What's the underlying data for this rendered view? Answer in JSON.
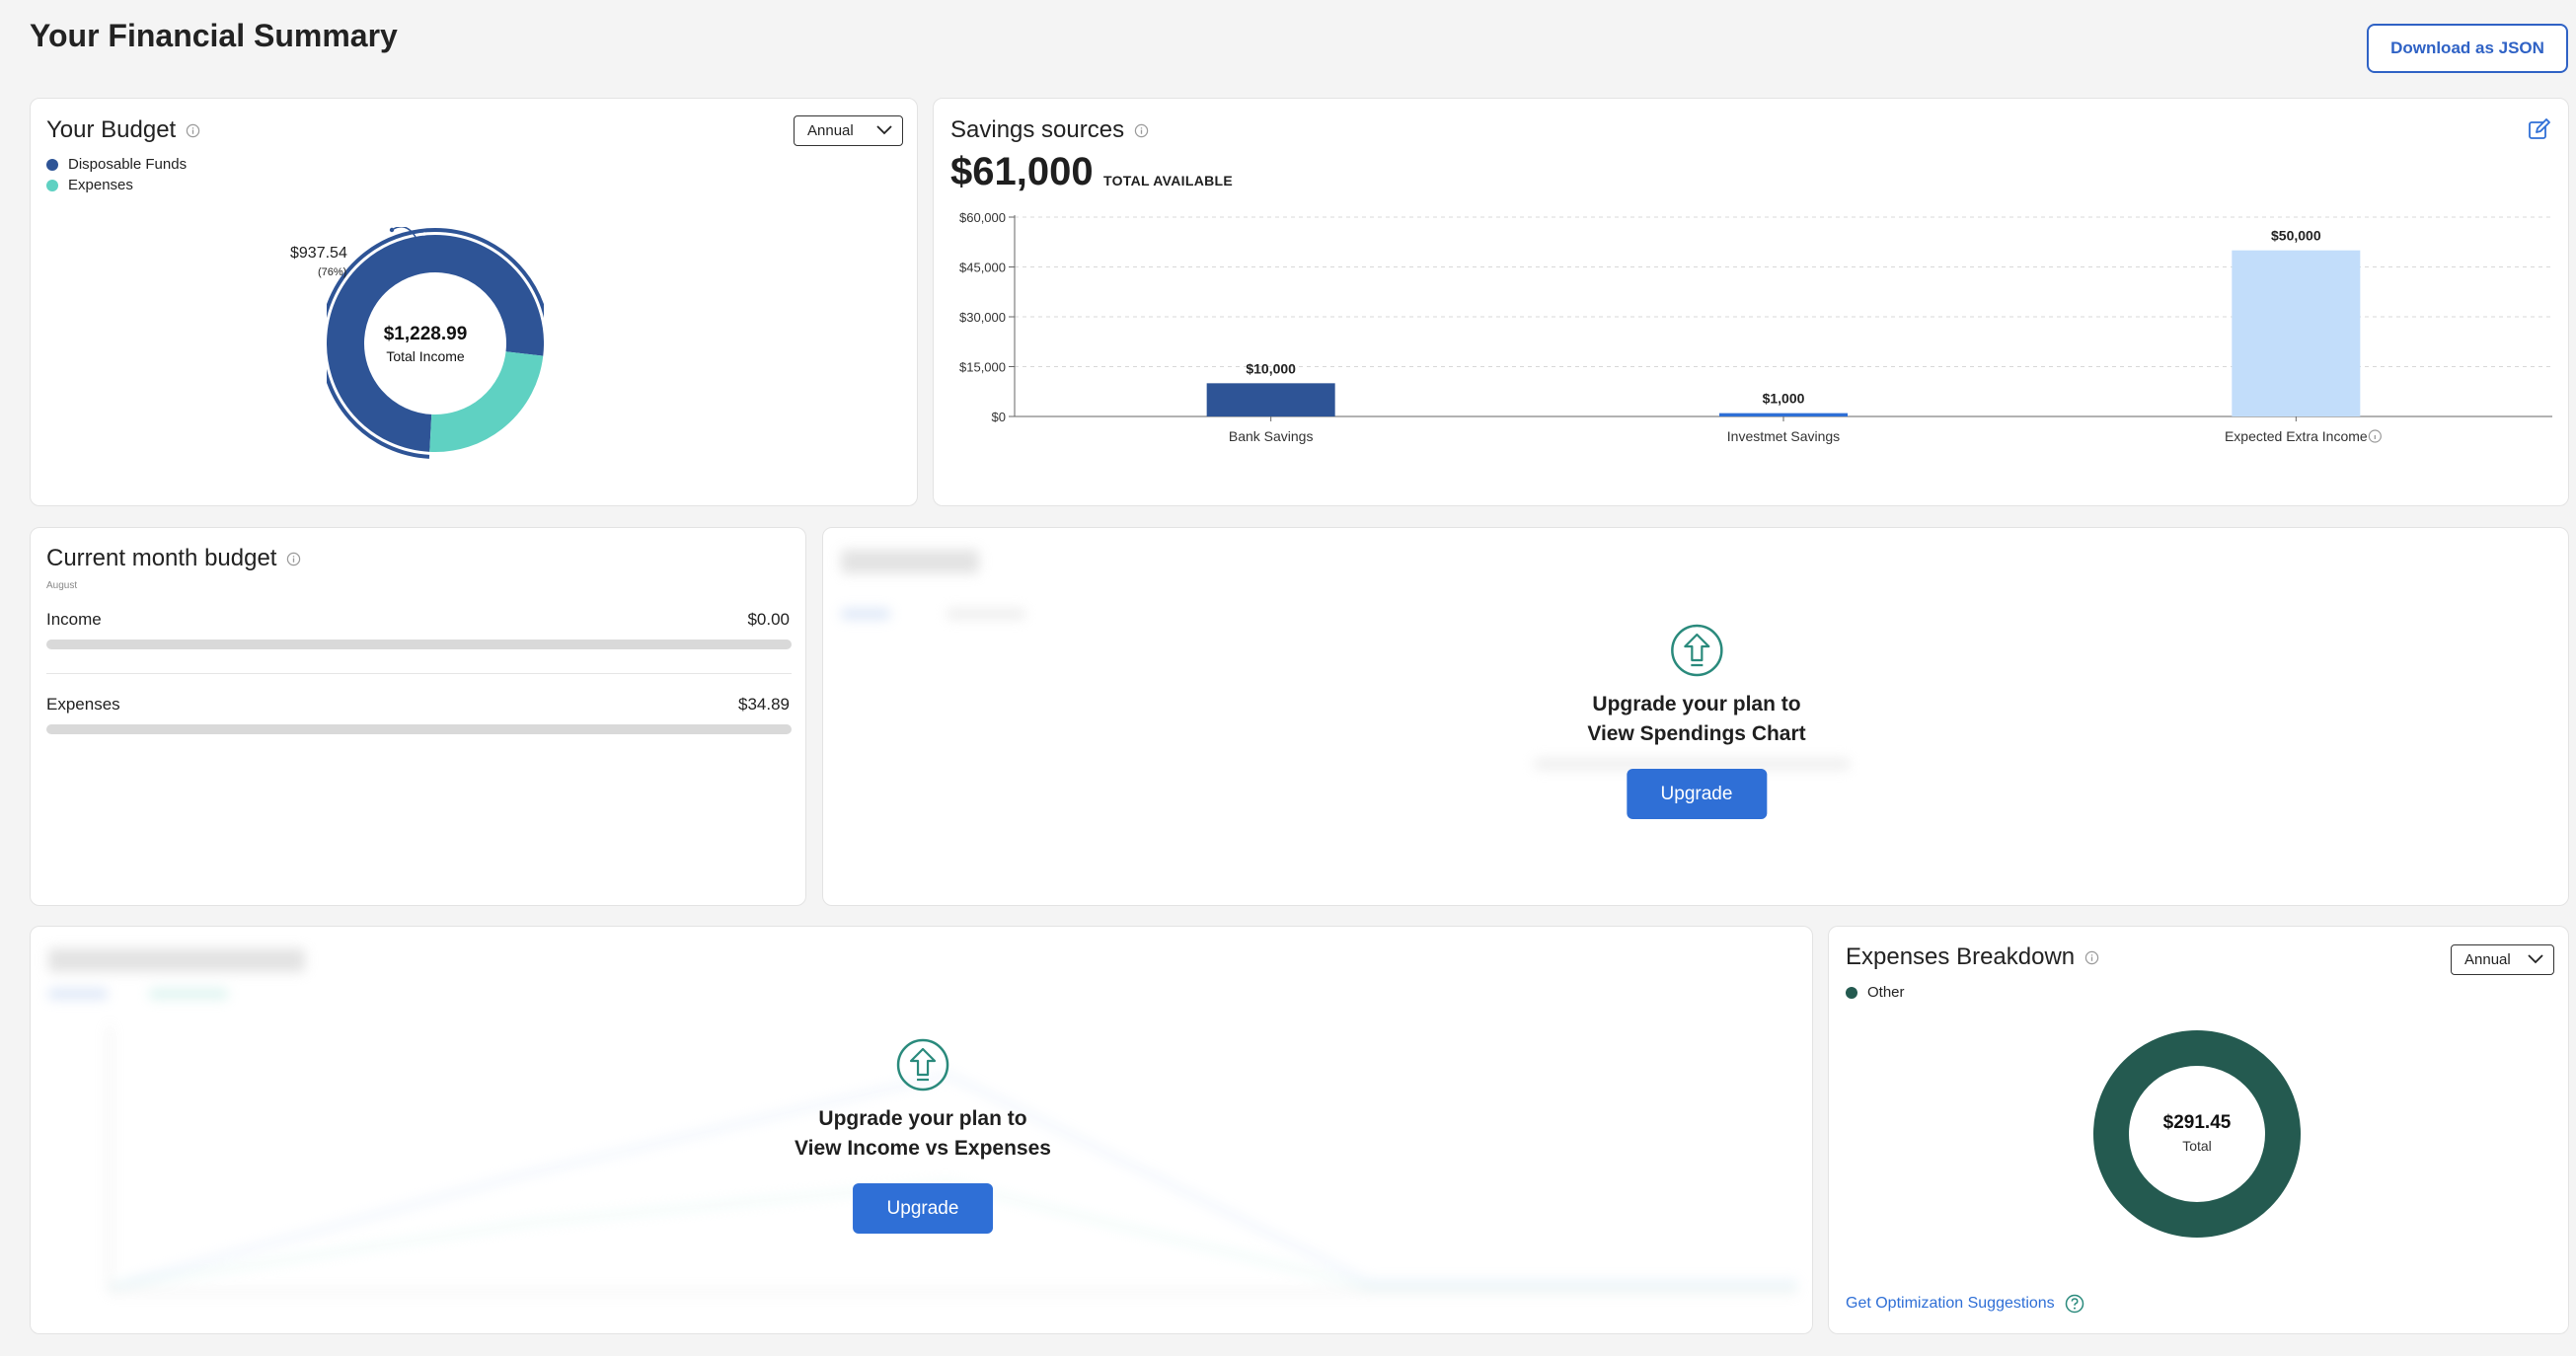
{
  "header": {
    "title": "Your Financial Summary",
    "download_label": "Download as JSON"
  },
  "budget": {
    "title": "Your Budget",
    "period": "Annual",
    "legend": [
      {
        "label": "Disposable Funds",
        "color": "#2e5496"
      },
      {
        "label": "Expenses",
        "color": "#5fd1c2"
      }
    ],
    "total_amount": "$1,228.99",
    "total_label": "Total Income",
    "callout_amount": "$937.54",
    "callout_pct": "(76%)",
    "disposable_share": 0.76
  },
  "savings": {
    "title": "Savings sources",
    "total": "$61,000",
    "total_label": "TOTAL AVAILABLE",
    "edit_icon": "edit-icon"
  },
  "chart_data": {
    "type": "bar",
    "categories": [
      "Bank Savings",
      "Investmet Savings",
      "Expected Extra Income"
    ],
    "values": [
      10000,
      1000,
      50000
    ],
    "value_labels": [
      "$10,000",
      "$1,000",
      "$50,000"
    ],
    "colors": [
      "#2e5496",
      "#2e6fd6",
      "#c2ddfa"
    ],
    "yticks": [
      "$60,000",
      "$45,000",
      "$30,000",
      "$15,000",
      "$0"
    ],
    "ytick_values": [
      60000,
      45000,
      30000,
      15000,
      0
    ],
    "ylim": [
      0,
      60000
    ],
    "grid": true,
    "legend": "none"
  },
  "current_month": {
    "title": "Current month budget",
    "month": "August",
    "rows": [
      {
        "label": "Income",
        "value": "$0.00"
      },
      {
        "label": "Expenses",
        "value": "$34.89"
      }
    ]
  },
  "spendings_locked": {
    "line1": "Upgrade your plan to",
    "line2": "View Spendings Chart",
    "button": "Upgrade"
  },
  "income_locked": {
    "line1": "Upgrade your plan to",
    "line2": "View Income vs Expenses",
    "button": "Upgrade"
  },
  "expenses_breakdown": {
    "title": "Expenses Breakdown",
    "period": "Annual",
    "legend": [
      {
        "label": "Other",
        "color": "#245a50"
      }
    ],
    "total_amount": "$291.45",
    "total_label": "Total",
    "link": "Get Optimization Suggestions"
  }
}
